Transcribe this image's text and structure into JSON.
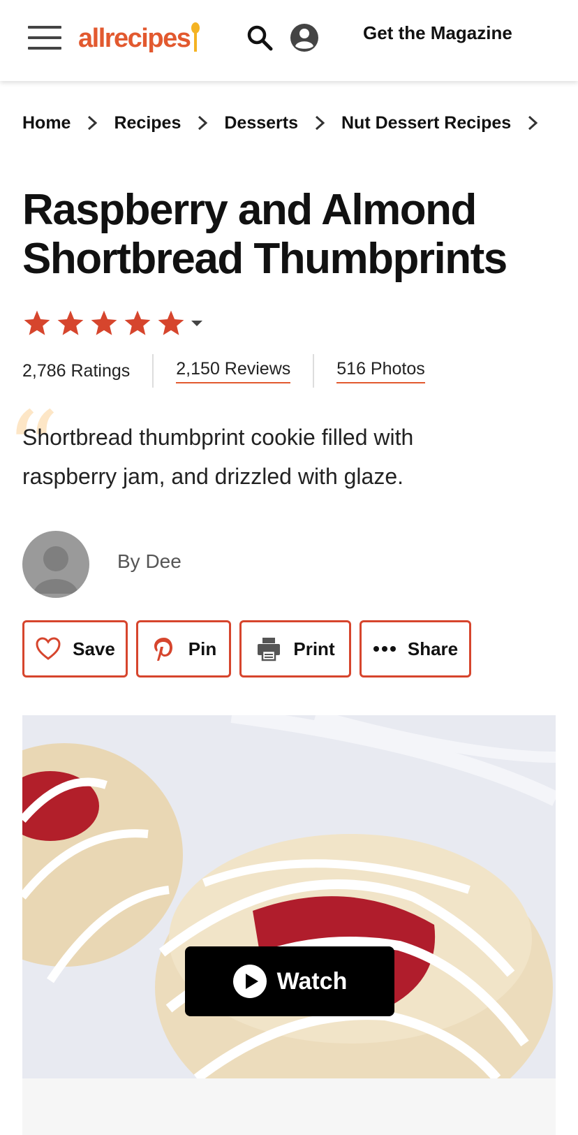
{
  "header": {
    "logo_text": "allrecipes",
    "magazine_link": "Get the Magazine",
    "icons": [
      "hamburger-menu-icon",
      "search-icon",
      "account-icon"
    ]
  },
  "breadcrumb": [
    "Home",
    "Recipes",
    "Desserts",
    "Nut Dessert Recipes"
  ],
  "recipe": {
    "title": "Raspberry and Almond Shortbread Thumbprints",
    "stars": 5,
    "ratings": "2,786 Ratings",
    "reviews": "2,150 Reviews",
    "photos": "516 Photos",
    "description": "Shortbread thumbprint cookie filled with raspberry jam, and drizzled with glaze.",
    "byline": "By Dee"
  },
  "actions": {
    "save": "Save",
    "pin": "Pin",
    "print": "Print",
    "share": "Share"
  },
  "media": {
    "watch_label": "Watch"
  },
  "colors": {
    "brand": "#e2592f",
    "star": "#d6452d",
    "button_border": "#d6452d"
  }
}
